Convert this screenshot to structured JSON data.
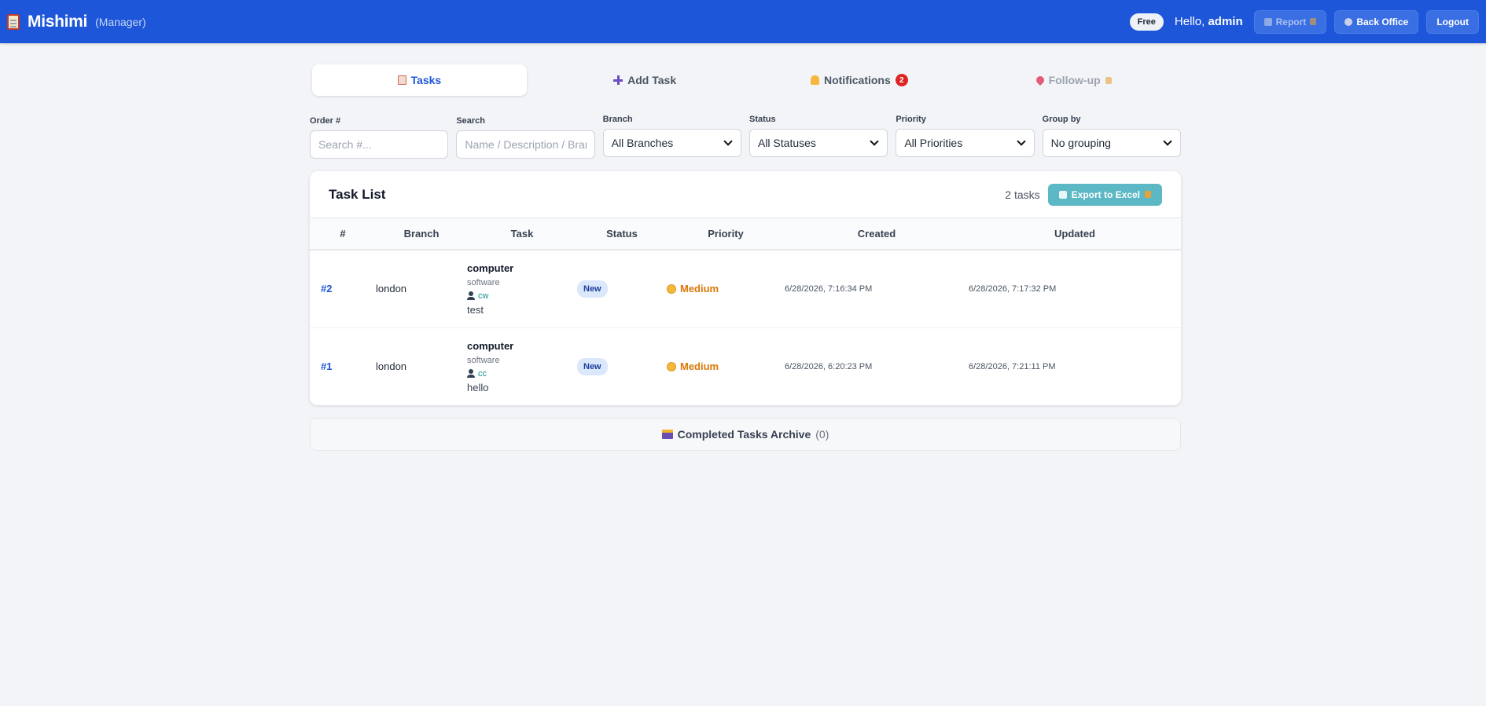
{
  "header": {
    "app_name": "Mishimi",
    "role": "(Manager)",
    "plan": "Free",
    "greeting_prefix": "Hello,",
    "username": "admin",
    "report_label": "Report",
    "back_office_label": "Back Office",
    "logout_label": "Logout"
  },
  "tabs": [
    {
      "label": "Tasks"
    },
    {
      "label": "Add Task"
    },
    {
      "label": "Notifications",
      "badge": "2"
    },
    {
      "label": "Follow-up"
    }
  ],
  "filters": {
    "order": {
      "label": "Order #",
      "placeholder": "Search #..."
    },
    "search": {
      "label": "Search",
      "placeholder": "Name / Description / Branch"
    },
    "branch": {
      "label": "Branch",
      "value": "All Branches"
    },
    "status": {
      "label": "Status",
      "value": "All Statuses"
    },
    "priority": {
      "label": "Priority",
      "value": "All Priorities"
    },
    "group": {
      "label": "Group by",
      "value": "No grouping"
    }
  },
  "task_list": {
    "title": "Task List",
    "count": "2 tasks",
    "export_label": "Export to Excel",
    "columns": [
      "#",
      "Branch",
      "Task",
      "Status",
      "Priority",
      "Created",
      "Updated"
    ],
    "rows": [
      {
        "id": "#2",
        "branch": "london",
        "name": "computer",
        "category": "software",
        "user": "cw",
        "note": "test",
        "status": "New",
        "priority": "Medium",
        "created": "6/28/2026, 7:16:34 PM",
        "updated": "6/28/2026, 7:17:32 PM"
      },
      {
        "id": "#1",
        "branch": "london",
        "name": "computer",
        "category": "software",
        "user": "cc",
        "note": "hello",
        "status": "New",
        "priority": "Medium",
        "created": "6/28/2026, 6:20:23 PM",
        "updated": "6/28/2026, 7:21:11 PM"
      }
    ]
  },
  "archive": {
    "label": "Completed Tasks Archive",
    "count": "(0)"
  },
  "colors": {
    "primary": "#1d56d8",
    "export": "#5bb8c4",
    "medium_priority": "#d97706",
    "badge_red": "#dc2626"
  }
}
